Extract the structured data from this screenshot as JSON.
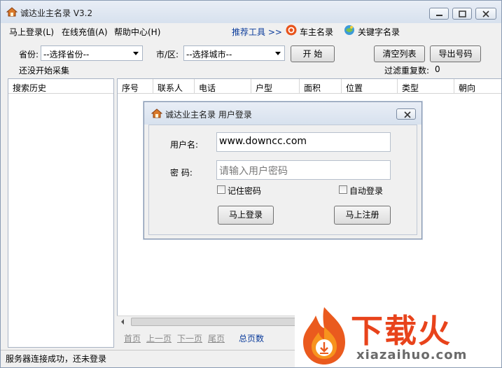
{
  "window": {
    "title": "诚达业主名录 V3.2"
  },
  "menu": {
    "items": [
      "马上登录(L)",
      "在线充值(A)",
      "帮助中心(H)"
    ]
  },
  "toolbar": {
    "recommend": "推荐工具 >>",
    "tool1": "车主名录",
    "tool2": "关键字名录"
  },
  "filters": {
    "province_label": "省份:",
    "province_value": "--选择省份--",
    "city_label": "市/区:",
    "city_value": "--选择城市--",
    "start_button": "开 始",
    "clear_button": "清空列表",
    "export_button": "导出号码",
    "status_text": "还没开始采集",
    "dedupe_label": "过滤重复数:",
    "dedupe_count": "0"
  },
  "history": {
    "header": "搜索历史"
  },
  "grid": {
    "columns": [
      "序号",
      "联系人",
      "电话",
      "户型",
      "面积",
      "位置",
      "类型",
      "朝向"
    ]
  },
  "pager": {
    "first": "首页",
    "prev": "上一页",
    "next": "下一页",
    "last": "尾页",
    "total": "总页数"
  },
  "statusbar": {
    "text": "服务器连接成功，还未登录"
  },
  "login": {
    "title": "诚达业主名录 用户登录",
    "username_label": "用户名:",
    "username_value": "www.downcc.com",
    "password_label": "密   码:",
    "password_placeholder": "请输入用户密码",
    "remember_label": "记住密码",
    "auto_login_label": "自动登录",
    "login_button": "马上登录",
    "register_button": "马上注册"
  },
  "watermark": {
    "logo_text": "下载火",
    "domain": "xiazaihuo.com"
  },
  "colors": {
    "accent": "#0a3b9b",
    "brand_orange": "#e8431b",
    "title_bar": "#dce5f0"
  }
}
